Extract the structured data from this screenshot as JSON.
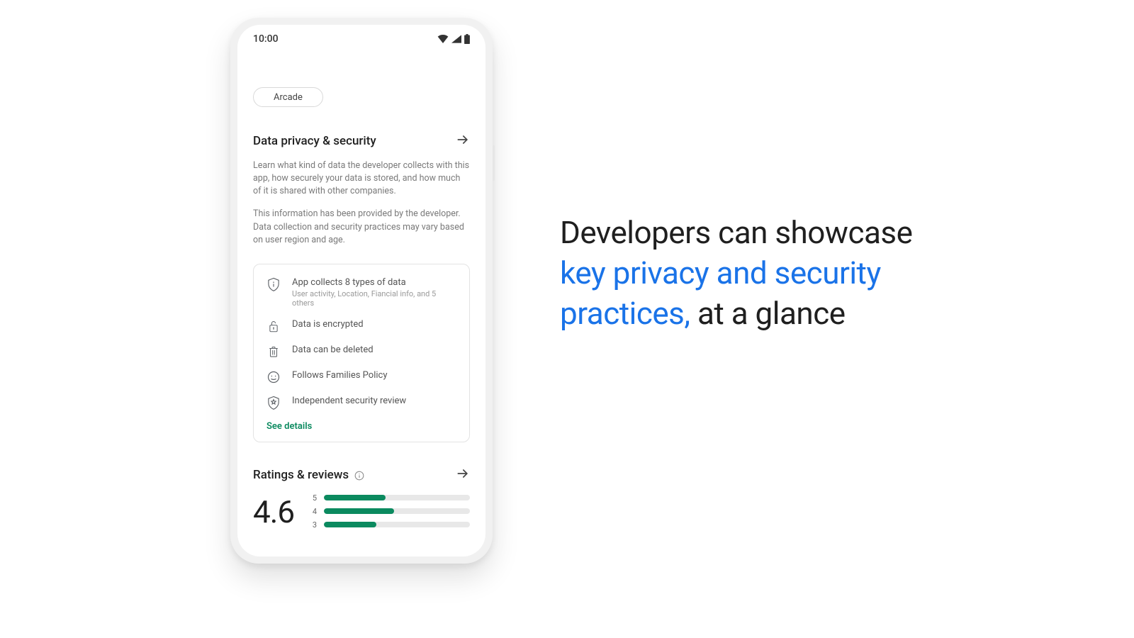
{
  "status": {
    "time": "10:00"
  },
  "chip": {
    "label": "Arcade"
  },
  "privacy_section": {
    "title": "Data privacy & security",
    "paragraph1": "Learn what kind of data the developer collects with this app, how securely your data is stored, and how much of it is shared with other companies.",
    "paragraph2": "This information has been provided by the developer. Data collection and security practices may vary based on user region and age."
  },
  "card": {
    "items": [
      {
        "icon": "shield-info-icon",
        "title": "App collects 8 types of data",
        "subtitle": "User activity, Location, Fiancial info, and 5 others"
      },
      {
        "icon": "lock-icon",
        "title": "Data is encrypted"
      },
      {
        "icon": "trash-icon",
        "title": "Data can be deleted"
      },
      {
        "icon": "smile-icon",
        "title": "Follows Families Policy"
      },
      {
        "icon": "shield-star-icon",
        "title": "Independent security review"
      }
    ],
    "see_details": "See details"
  },
  "ratings": {
    "title": "Ratings & reviews",
    "score": "4.6",
    "bars": [
      {
        "n": "5",
        "pct": 42
      },
      {
        "n": "4",
        "pct": 48
      },
      {
        "n": "3",
        "pct": 36
      }
    ]
  },
  "headline": {
    "part1": "Developers can showcase ",
    "part2": "key privacy and security practices,",
    "part3": " at a glance"
  }
}
